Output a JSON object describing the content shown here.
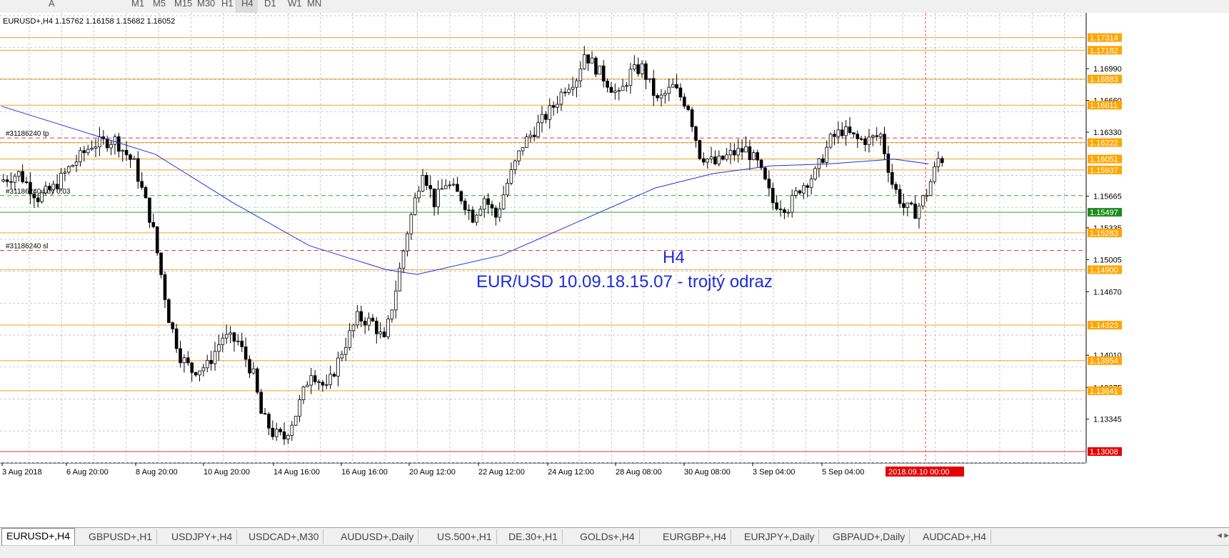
{
  "toolbar": {
    "items": [
      "A",
      "M1",
      "M5",
      "M15",
      "M30",
      "H1",
      "H4",
      "D1",
      "W1",
      "MN"
    ],
    "active": "H4"
  },
  "chart": {
    "header": "EURUSD+,H4  1.15762 1.16158 1.15682 1.16052",
    "label_h4": "H4",
    "annotation": "EUR/USD 10.09.18.15.07 - trojtý odraz",
    "order_labels": {
      "tp": "#31186240 tp",
      "buy": "#31186240 buy 0.03",
      "sl": "#31186240 sl"
    },
    "price_axis": [
      "1.16990",
      "1.16660",
      "1.16330",
      "1.15665",
      "1.15335",
      "1.15005",
      "1.14670",
      "1.14010",
      "1.13675",
      "1.13345"
    ],
    "level_tags": [
      {
        "v": "1.17314",
        "c": "#ffa500"
      },
      {
        "v": "1.17182",
        "c": "#ffa500"
      },
      {
        "v": "1.16883",
        "c": "#ffa500"
      },
      {
        "v": "1.16611",
        "c": "#ffa500"
      },
      {
        "v": "1.16222",
        "c": "#ffa500"
      },
      {
        "v": "1.16051",
        "c": "#ffa500"
      },
      {
        "v": "1.15937",
        "c": "#ffa500"
      },
      {
        "v": "1.15497",
        "c": "#1e8c1e"
      },
      {
        "v": "1.15283",
        "c": "#ffa500"
      },
      {
        "v": "1.14900",
        "c": "#ffa500"
      },
      {
        "v": "1.14323",
        "c": "#ffa500"
      },
      {
        "v": "1.13954",
        "c": "#ffa500"
      },
      {
        "v": "1.13641",
        "c": "#ffa500"
      },
      {
        "v": "1.13008",
        "c": "#e60000"
      }
    ],
    "time_axis": [
      "3 Aug 2018",
      "6 Aug 20:00",
      "8 Aug 20:00",
      "10 Aug 20:00",
      "14 Aug 16:00",
      "16 Aug 16:00",
      "20 Aug 12:00",
      "22 Aug 12:00",
      "24 Aug 12:00",
      "28 Aug 08:00",
      "30 Aug 08:00",
      "3 Sep 04:00",
      "5 Sep 04:00"
    ],
    "time_cursor": "2018.09.10 00:00"
  },
  "tabs": {
    "items": [
      "EURUSD+,H4",
      "GBPUSD+,H1",
      "USDJPY+,H4",
      "USDCAD+,M30",
      "AUDUSD+,Daily",
      "US.500+,H1",
      "DE.30+,H1",
      "GOLDs+,H4",
      "EURGBP+,H4",
      "EURJPY+,Daily",
      "GBPAUD+,Daily",
      "AUDCAD+,H4"
    ],
    "active_index": 0
  },
  "colors": {
    "background": "#ffffff",
    "grid": "#a9b4c0",
    "level_line": "#f0a030",
    "ma_line": "#2233dd",
    "order_line_red": "#e23b3b",
    "order_line_green": "#2eaa2e",
    "annotation_text": "#1f2bdc"
  }
}
